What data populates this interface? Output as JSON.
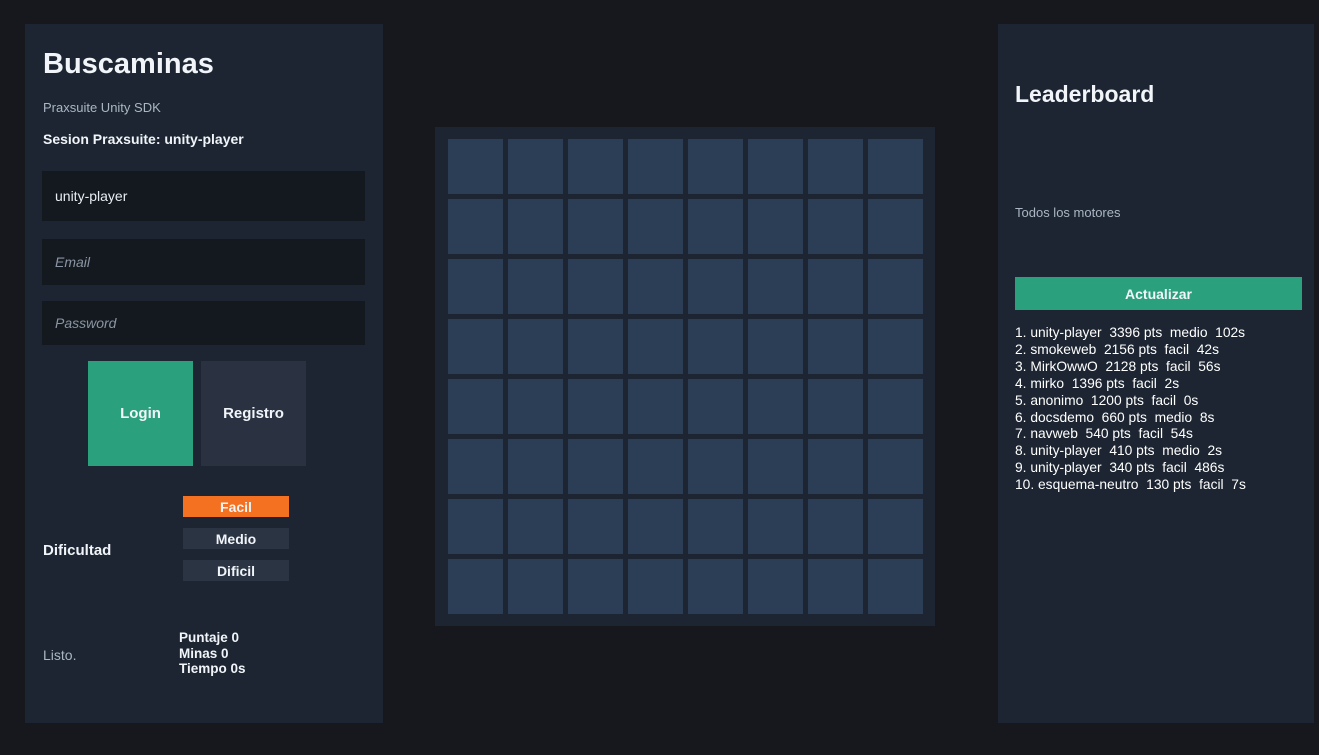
{
  "left_panel": {
    "title": "Buscaminas",
    "subtitle": "Praxsuite Unity SDK",
    "session": "Sesion Praxsuite: unity-player",
    "username_value": "unity-player",
    "email_placeholder": "Email",
    "password_placeholder": "Password",
    "login_label": "Login",
    "register_label": "Registro",
    "difficulty_label": "Dificultad",
    "difficulty_options": [
      "Facil",
      "Medio",
      "Dificil"
    ],
    "difficulty_selected": "Facil",
    "status": "Listo.",
    "stats": {
      "score": "Puntaje 0",
      "mines": "Minas 0",
      "time": "Tiempo 0s"
    }
  },
  "board": {
    "rows": 8,
    "cols": 8,
    "cell_color": "#2c3e56"
  },
  "leaderboard": {
    "title": "Leaderboard",
    "filter": "Todos los motores",
    "refresh_label": "Actualizar",
    "entries": [
      "1. unity-player  3396 pts  medio  102s",
      "2. smokeweb  2156 pts  facil  42s",
      "3. MirkOwwO  2128 pts  facil  56s",
      "4. mirko  1396 pts  facil  2s",
      "5. anonimo  1200 pts  facil  0s",
      "6. docsdemo  660 pts  medio  8s",
      "7. navweb  540 pts  facil  54s",
      "8. unity-player  410 pts  medio  2s",
      "9. unity-player  340 pts  facil  486s",
      "10. esquema-neutro  130 pts  facil  7s"
    ]
  },
  "colors": {
    "background": "#17181d",
    "panel": "#1c2531",
    "accent_green": "#2aa07c",
    "selected_orange": "#f37121"
  }
}
